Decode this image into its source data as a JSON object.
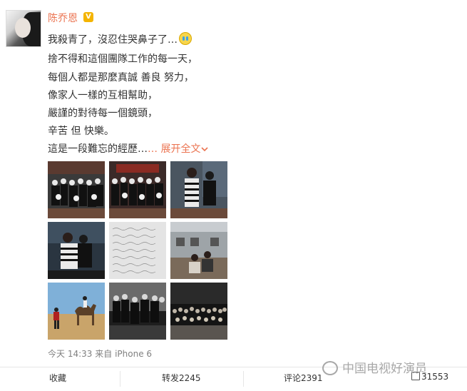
{
  "user": {
    "name": "陈乔恩",
    "verified_badge": "V"
  },
  "post": {
    "lines": [
      "我殺青了，沒忍住哭鼻子了…",
      "捨不得和這個團隊工作的每一天，",
      "每個人都是那麼真誠 善良 努力，",
      "像家人一樣的互相幫助，",
      "嚴謹的對待每一個鏡頭，",
      "辛苦 但 快樂。",
      "這是一段難忘的經歷…"
    ],
    "expand_label": "… 展开全文",
    "expand_icon": "chevron-down-icon",
    "emoji_icon": "crying-face-icon"
  },
  "photos": [
    {
      "name": "photo-group-1"
    },
    {
      "name": "photo-group-2"
    },
    {
      "name": "photo-dance"
    },
    {
      "name": "photo-hug"
    },
    {
      "name": "photo-handwritten-note"
    },
    {
      "name": "photo-outdoor-building"
    },
    {
      "name": "photo-camel-desert"
    },
    {
      "name": "photo-group-bw"
    },
    {
      "name": "photo-night-group"
    }
  ],
  "meta": {
    "time": "今天 14:33",
    "source_prefix": "来自",
    "source": "iPhone 6"
  },
  "actions": {
    "favorite": "收藏",
    "repost": "转发2245",
    "comment": "评论2391",
    "like": "31553"
  },
  "watermark": {
    "text": "中国电视好演员"
  },
  "colors": {
    "accent": "#eb7350",
    "text": "#333333",
    "meta": "#808080"
  }
}
